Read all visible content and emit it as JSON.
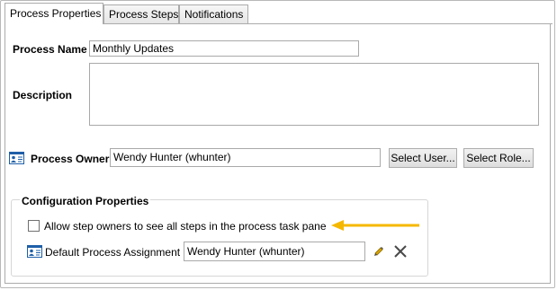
{
  "tabs": [
    "Process Properties",
    "Process Steps",
    "Notifications"
  ],
  "form": {
    "process_name_label": "Process Name",
    "process_name_value": "Monthly Updates",
    "description_label": "Description",
    "description_value": "",
    "process_owner_label": "Process Owner",
    "process_owner_value": "Wendy Hunter (whunter)",
    "select_user_button": "Select User...",
    "select_role_button": "Select Role..."
  },
  "config": {
    "title": "Configuration Properties",
    "allow_checkbox_label": "Allow step owners to see all steps in the process task pane",
    "allow_checkbox_checked": false,
    "default_assignment_label": "Default Process Assignment",
    "default_assignment_value": "Wendy Hunter (whunter)"
  },
  "colors": {
    "arrow": "#f5b800",
    "card_icon": "#1e5fa8"
  },
  "icons": {
    "owner": "user-card-icon",
    "assignment": "user-card-icon",
    "edit": "pencil-icon",
    "clear": "x-icon",
    "annotation": "arrow-left-icon"
  }
}
